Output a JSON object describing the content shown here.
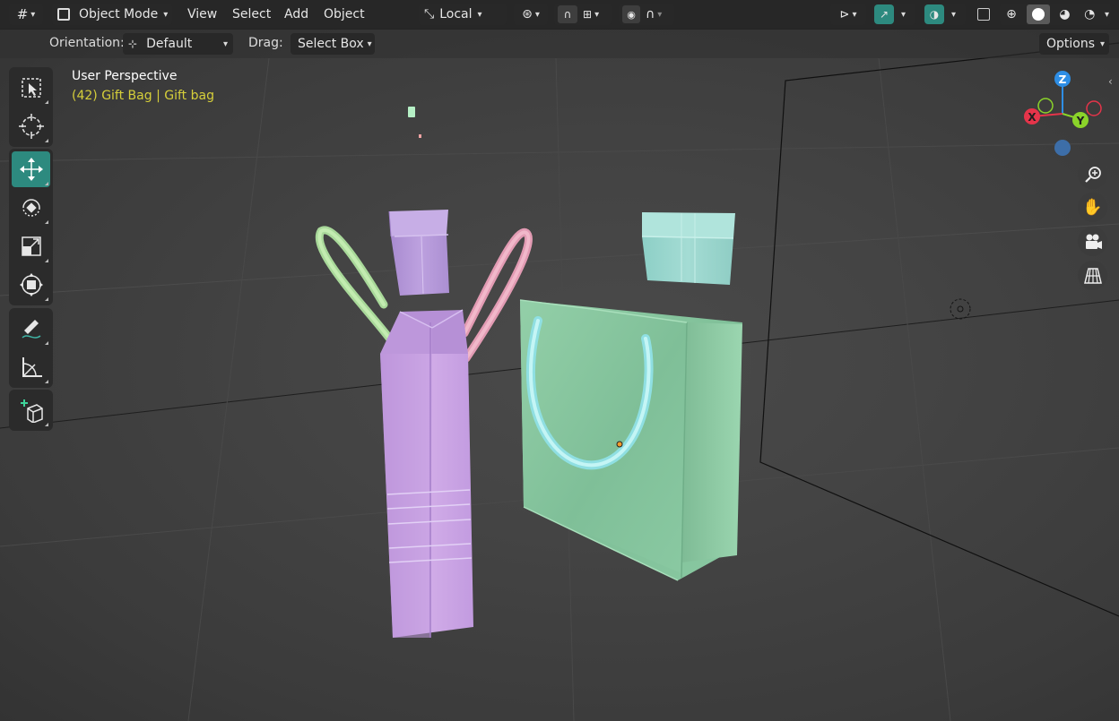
{
  "header": {
    "editor_type_icon": "grid-axes-icon",
    "mode": {
      "icon": "object-mode-icon",
      "label": "Object Mode"
    },
    "menus": [
      "View",
      "Select",
      "Add",
      "Object"
    ],
    "transform_orientation": {
      "icon": "local-axes-icon",
      "label": "Local"
    },
    "pivot_icon": "pivot-point-icon",
    "snap_icon": "magnet-icon",
    "snap_target_icon": "snap-increment-icon",
    "proportional_icon": "proportional-editing-icon",
    "falloff_icon": "falloff-curve-icon",
    "visibility_icon": "selectability-icon",
    "gizmo_icon": "gizmo-toggle-icon",
    "overlay_icon": "overlays-icon",
    "xray_icon": "xray-icon",
    "shading_icons": [
      "wireframe-shading-icon",
      "solid-shading-icon",
      "material-preview-icon",
      "rendered-shading-icon"
    ]
  },
  "subheader": {
    "orientation_label": "Orientation:",
    "orientation_value": "Default",
    "drag_label": "Drag:",
    "drag_value": "Select Box",
    "options_label": "Options"
  },
  "toolbar": [
    {
      "name": "select-box",
      "icon": "select-box-icon",
      "active": false
    },
    {
      "name": "cursor",
      "icon": "cursor-icon",
      "active": false
    },
    {
      "name": "move",
      "icon": "move-icon",
      "active": true
    },
    {
      "name": "rotate",
      "icon": "rotate-icon",
      "active": false
    },
    {
      "name": "scale",
      "icon": "scale-icon",
      "active": false
    },
    {
      "name": "transform",
      "icon": "transform-icon",
      "active": false
    },
    {
      "name": "annotate",
      "icon": "annotate-icon",
      "active": false
    },
    {
      "name": "measure",
      "icon": "measure-icon",
      "active": false
    },
    {
      "name": "add-cube",
      "icon": "add-cube-icon",
      "active": false
    }
  ],
  "viewport": {
    "view_name": "User Perspective",
    "object_info": "(42) Gift Bag | Gift bag"
  },
  "navigation": {
    "axes": {
      "x": "X",
      "y": "Y",
      "z": "Z"
    },
    "axis_colors": {
      "x": "#e5344a",
      "y": "#8bd42a",
      "z": "#2e8ee5",
      "neg": "#3d6ea8"
    },
    "buttons": [
      "zoom-icon",
      "pan-hand-icon",
      "camera-view-icon",
      "ortho-grid-icon"
    ]
  },
  "colors": {
    "accent": "#2d8a7f",
    "object_info": "#d6cf3a",
    "bag_purple": "#c8a3e0",
    "bag_green": "#8ccaa6",
    "handle_cyan": "#aeeef0",
    "box_purple": "#b59ad8",
    "box_cyan": "#9ad7cf"
  }
}
